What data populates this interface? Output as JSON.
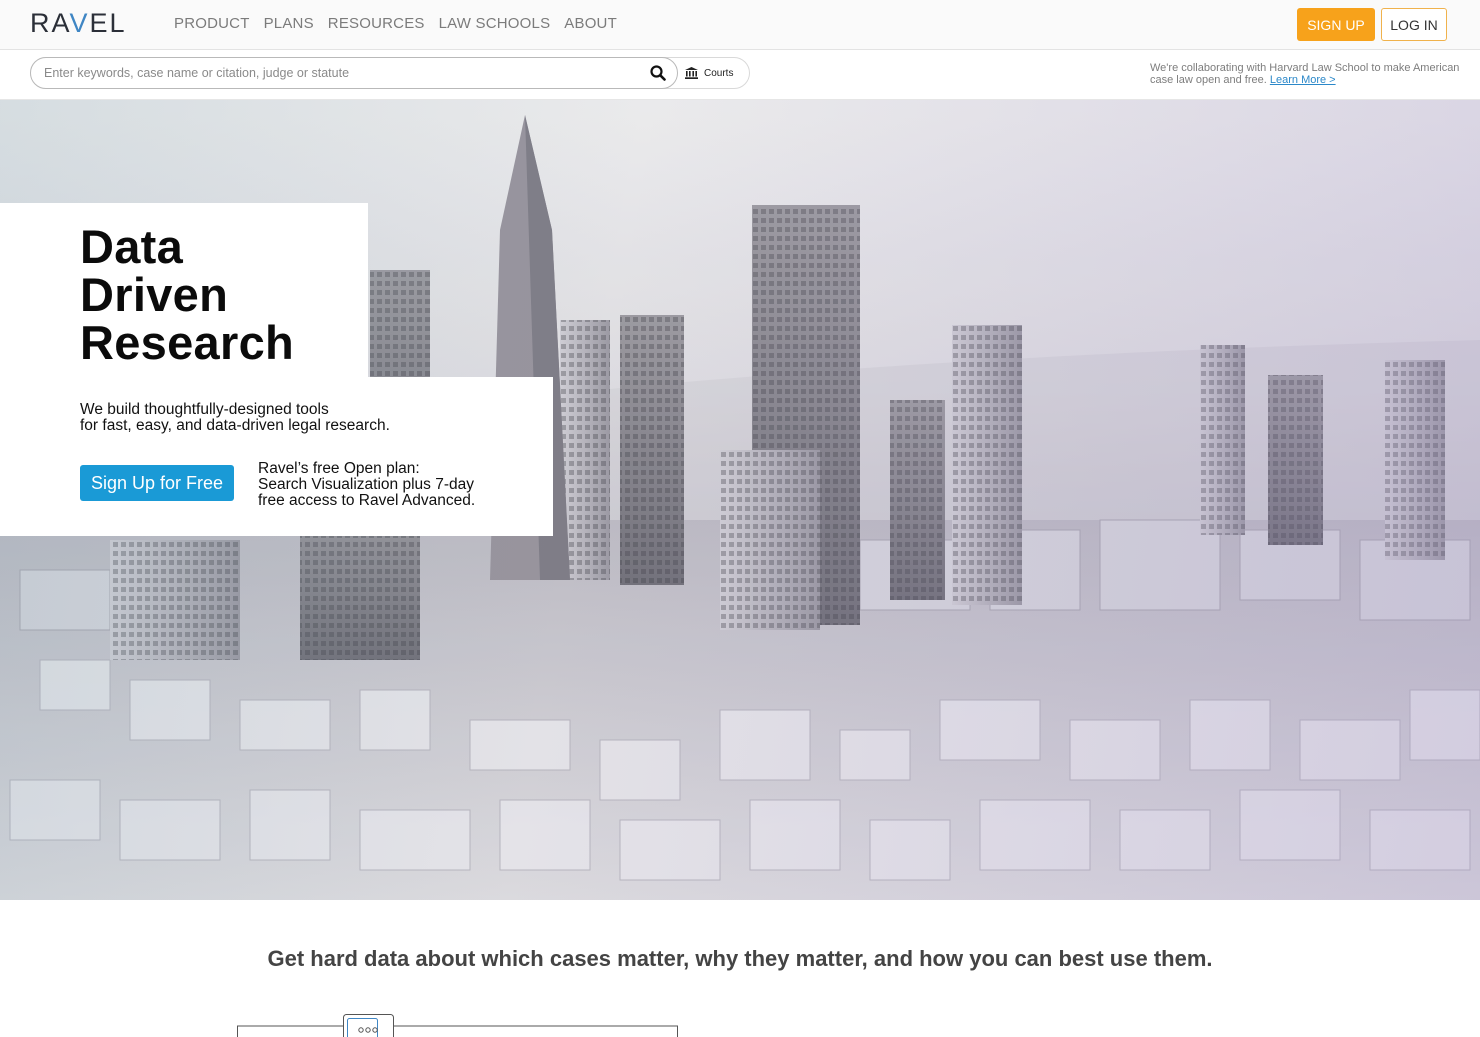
{
  "brand": {
    "logo_pre": "RA",
    "logo_v": "V",
    "logo_post": "EL",
    "accent": "#3f86c4"
  },
  "nav": {
    "items": [
      {
        "label": "PRODUCT"
      },
      {
        "label": "PLANS"
      },
      {
        "label": "RESOURCES"
      },
      {
        "label": "LAW SCHOOLS"
      },
      {
        "label": "ABOUT"
      }
    ]
  },
  "auth": {
    "signup_label": "SIGN UP",
    "login_label": "LOG IN",
    "signup_color": "#f7a21b"
  },
  "search": {
    "placeholder": "Enter keywords, case name or citation, judge or statute",
    "value": "",
    "courts_label": "Courts"
  },
  "notice": {
    "text": "We're collaborating with Harvard Law School to make American case law open and free.",
    "link": "Learn More >"
  },
  "hero": {
    "headline_1": "Data",
    "headline_2": "Driven",
    "headline_3": "Research",
    "tagline_1": "We build thoughtfully-designed tools",
    "tagline_2": "for fast, easy, and data-driven legal research.",
    "cta_label": "Sign Up for Free",
    "cta_color": "#1a9ad6",
    "plan_1": "Ravel’s free Open plan:",
    "plan_2": "Search Visualization plus 7-day",
    "plan_3": "free access to Ravel Advanced."
  },
  "section": {
    "heading": "Get hard data about which cases matter, why they matter, and how you can best use them."
  }
}
